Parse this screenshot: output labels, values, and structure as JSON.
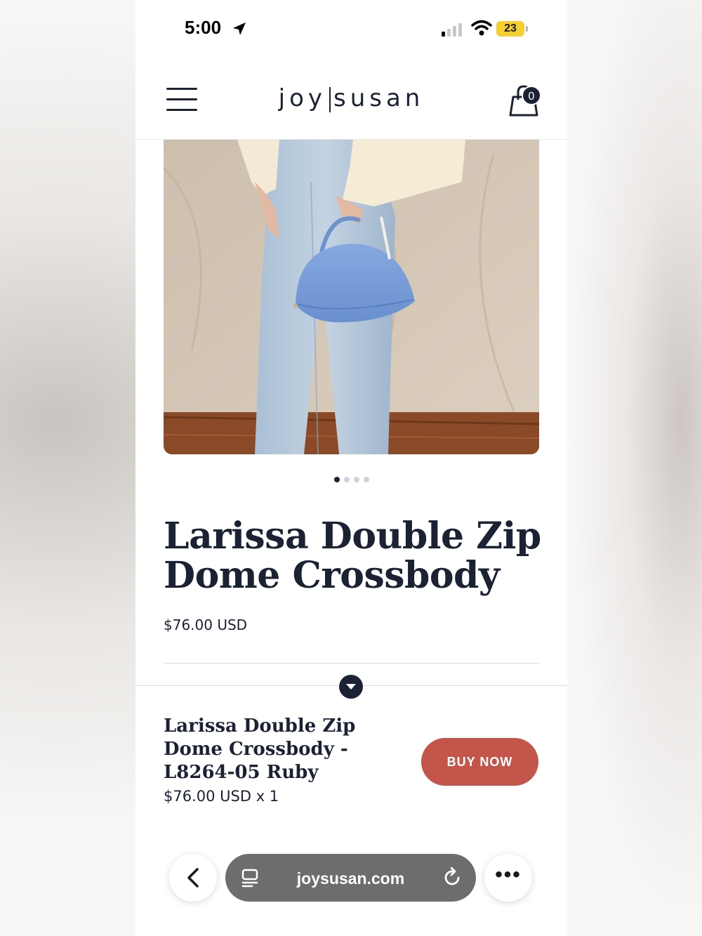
{
  "status_bar": {
    "time": "5:00",
    "battery": "23"
  },
  "header": {
    "logo_left": "joy",
    "logo_right": "susan",
    "cart_count": "0"
  },
  "gallery": {
    "active_index": 0,
    "total": 4
  },
  "product": {
    "title": "Larissa Double Zip Dome Crossbody",
    "price": "$76.00 USD"
  },
  "sticky_bar": {
    "name": "Larissa Double Zip Dome Crossbody - L8264-05 Ruby",
    "price_qty": "$76.00 USD x 1",
    "buy_label": "BUY NOW"
  },
  "browser": {
    "url": "joysusan.com",
    "more_label": "•••"
  },
  "colors": {
    "accent": "#c4554b",
    "navy": "#1b2233",
    "bag": "#7b9fd8"
  }
}
